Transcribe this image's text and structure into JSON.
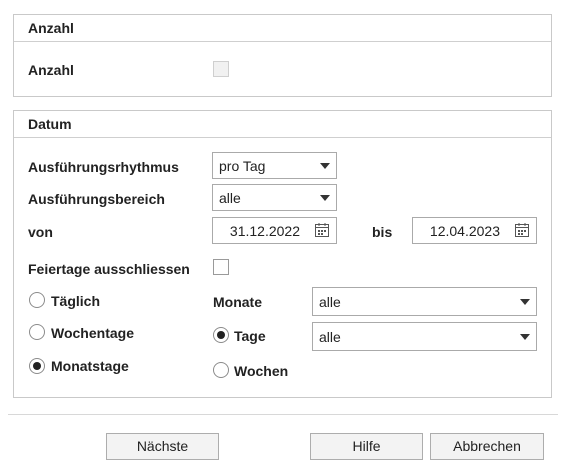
{
  "anzahl_section": {
    "title": "Anzahl",
    "anzahl_label": "Anzahl",
    "anzahl_checked": false
  },
  "datum_section": {
    "title": "Datum",
    "rhythmus_label": "Ausführungsrhythmus",
    "rhythmus_value": "pro Tag",
    "bereich_label": "Ausführungsbereich",
    "bereich_value": "alle",
    "von_label": "von",
    "von_value": "31.12.2022",
    "bis_label": "bis",
    "bis_value": "12.04.2023",
    "feiertage_label": "Feiertage ausschliessen",
    "feiertage_checked": false,
    "radio_taeglich": "Täglich",
    "radio_wochentage": "Wochentage",
    "radio_monatstage": "Monatstage",
    "monate_label": "Monate",
    "monate_value": "alle",
    "radio_tage": "Tage",
    "tage_value": "alle",
    "radio_wochen": "Wochen",
    "selected_period": "Monatstage",
    "selected_unit": "Tage"
  },
  "buttons": {
    "next": "Nächste",
    "help": "Hilfe",
    "cancel": "Abbrechen"
  },
  "icons": {
    "calendar": "calendar-icon",
    "dropdown": "chevron-down-icon"
  }
}
